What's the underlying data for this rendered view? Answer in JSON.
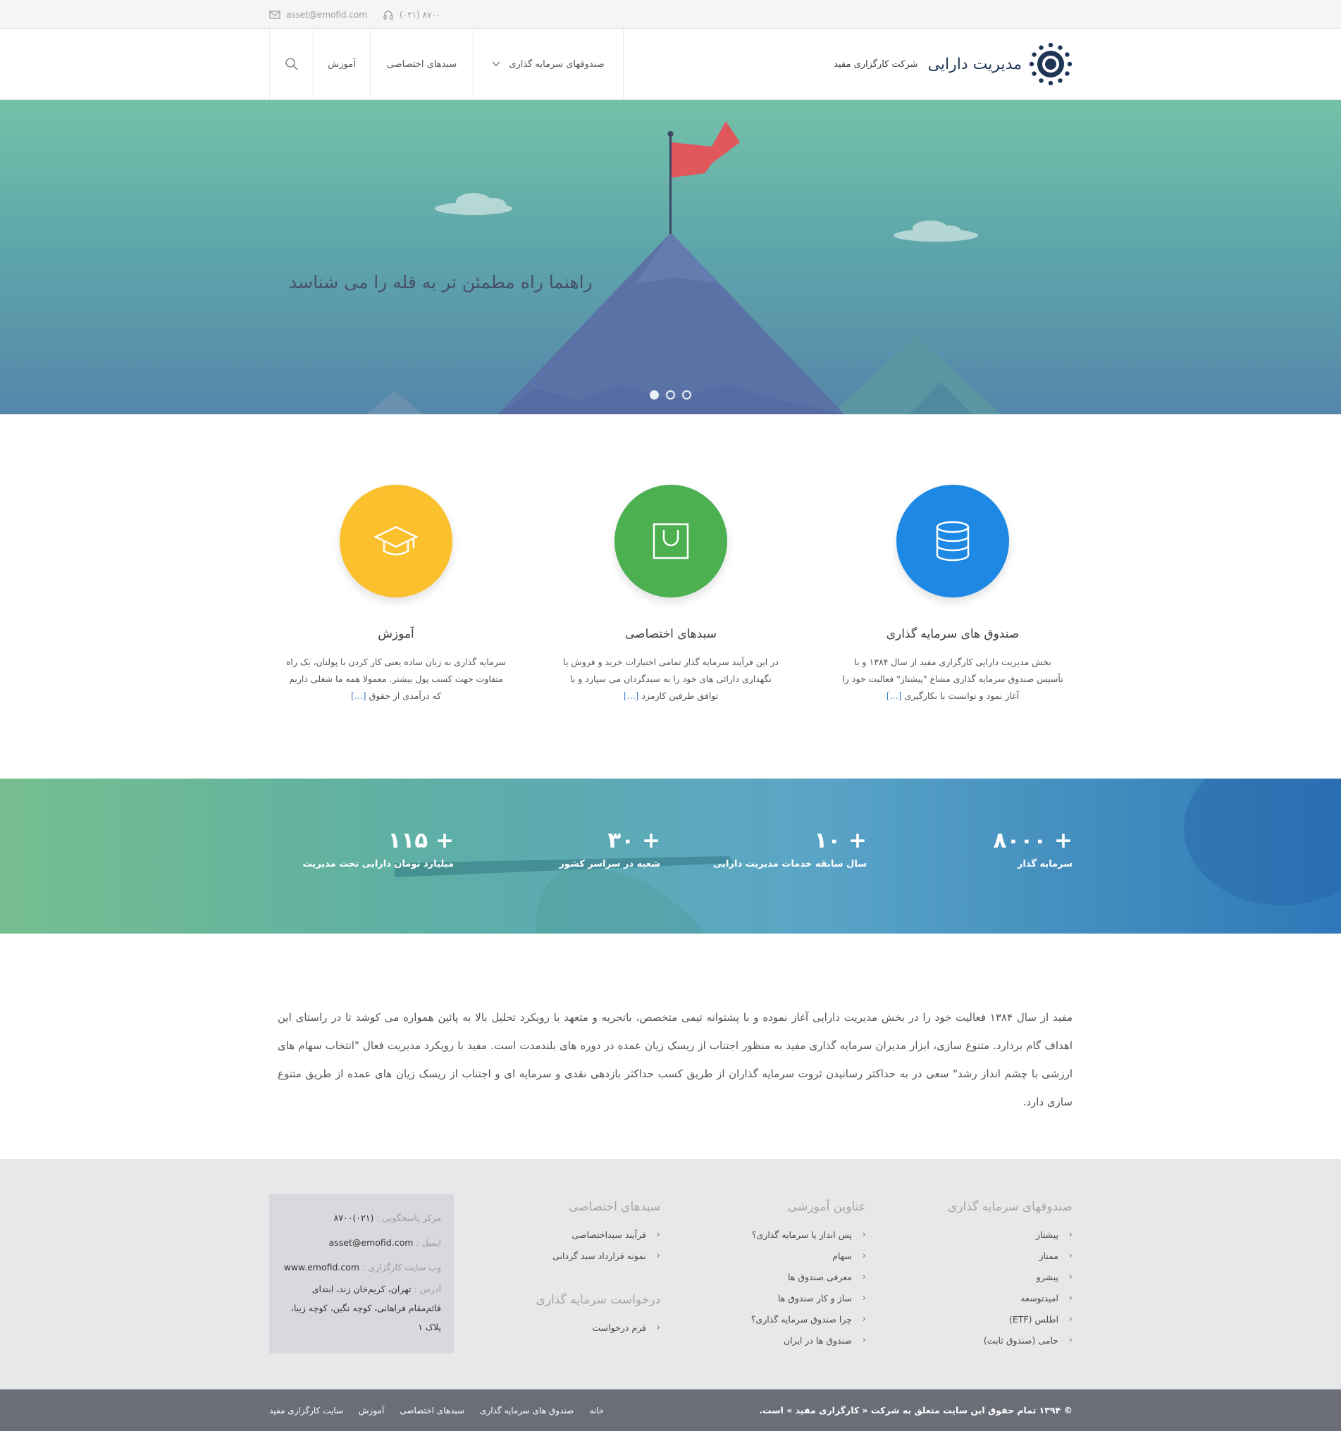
{
  "topbar": {
    "email": "asset@emofid.com",
    "phone": "(۰۲۱) ۸۷۰۰"
  },
  "header": {
    "brand_title": "مدیریت دارایی",
    "brand_sub": "شرکت کارگزاری مفید",
    "nav": [
      "صندوقهای سرمایه گذاری",
      "سبدهای اختصاصی",
      "آموزش"
    ]
  },
  "hero": {
    "tagline": "راهنما راه مطمئن تر به قله را می شناسد"
  },
  "services": [
    {
      "title": "صندوق های سرمایه گذاری",
      "desc": "بخش مدیریت دارایی کارگزاری مفید از سال ۱۳۸۴ و با تأسیس صندوق سرمایه گذاری مشاع \"پیشتاز\" فعالیت خود را آغاز نمود و توانست با بکارگیری",
      "more": "[...]",
      "color": "#1e88e5"
    },
    {
      "title": "سبدهای اختصاصی",
      "desc": "در این فرآیند سرمایه گذار تمامی اختیارات خرید و فروش یا نگهداری دارائی های خود را به سبدگردان می سپارد و با توافق طرفین کارمزد",
      "more": "[...]",
      "color": "#4caf50"
    },
    {
      "title": "آموزش",
      "desc": "سرمایه گذاری به زبان ساده یعنی کار کردن با پولتان، یک راه متفاوت جهت کسب پول بیشتر. معمولا همه ما شغلی داریم که درآمدی از حقوق",
      "more": "[...]",
      "color": "#fbc02d"
    }
  ],
  "stats": [
    {
      "num": "+ ۸۰۰۰",
      "label": "سرمایه گذار"
    },
    {
      "num": "+ ۱۰",
      "label": "سال سابقه خدمات مدیریت دارایی"
    },
    {
      "num": "+ ۳۰",
      "label": "شعبه در سراسر کشور"
    },
    {
      "num": "+ ۱۱۵",
      "label": "میلیارد تومان دارایی تحت مدیریت"
    }
  ],
  "about": {
    "text": "مفید از سال ۱۳۸۴ فعالیت خود را در بخش مدیریت دارایی آغاز نموده و با پشتوانه تیمی متخصص، باتجربه و متعهد با رویکرد تحلیل بالا به پائین همواره می کوشد تا در راستای این اهداف گام بردارد. متنوع سازی، ابزار مدیران سرمایه گذاری مفید به منظور اجتناب از ریسک زیان عمده در دوره های بلندمدت است. مفید با رویکرد مدیریت فعال \"انتخاب سهام های ارزشی با چشم انداز رشد\" سعی در به حداکثر رسانیدن ثروت سرمایه گذاران از طریق کسب حداکثر بازدهی نقدی و سرمایه ای و اجتناب از ریسک زیان های عمده از طریق متنوع سازی دارد."
  },
  "footer": {
    "funds": {
      "title": "صندوقهای سرمایه گذاری",
      "items": [
        "پیشتاز",
        "ممتاز",
        "پیشرو",
        "امیدتوسعه",
        "اطلس (ETF)",
        "حامی (صندوق ثابت)"
      ]
    },
    "edu": {
      "title": "عناوین آموزشی",
      "items": [
        "پس انداز یا سرمایه گذاری؟",
        "سهام",
        "معرفی صندوق ها",
        "ساز و کار صندوق ها",
        "چرا صندوق سرمایه گذاری؟",
        "صندوق ها در ایران"
      ]
    },
    "baskets": {
      "title": "سبدهای اختصاصی",
      "items": [
        "فرآیند سبداختصاصی",
        "نمونه قرارداد سبد گردانی"
      ]
    },
    "request": {
      "title": "درخواست سرمایه گذاری",
      "items": [
        "فرم درخواست"
      ]
    },
    "contact": {
      "support_k": "مرکز پاسخگویی : ",
      "support_v": "(۰۲۱)۸۷۰۰",
      "email_k": "ایمیل : ",
      "email_v": "asset@emofid.com",
      "web_k": "وب سایت کارگزاری : ",
      "web_v": "www.emofid.com",
      "addr_k": "آدرس : ",
      "addr_v": "تهران، کریم‌خان زند، ابتدای قائم‌مقام فراهانی، کوچه نگین، کوچه زیبا، پلاک ۱"
    }
  },
  "bottom": {
    "copy": "© ۱۳۹۴ تمام حقوق این سایت متعلق به شرکت « کارگزاری مفید » است.",
    "links": [
      "سایت کارگزاری مفید",
      "آموزش",
      "سبدهای اختصاصی",
      "صندوق های سرمایه گذاری",
      "خانه"
    ]
  }
}
